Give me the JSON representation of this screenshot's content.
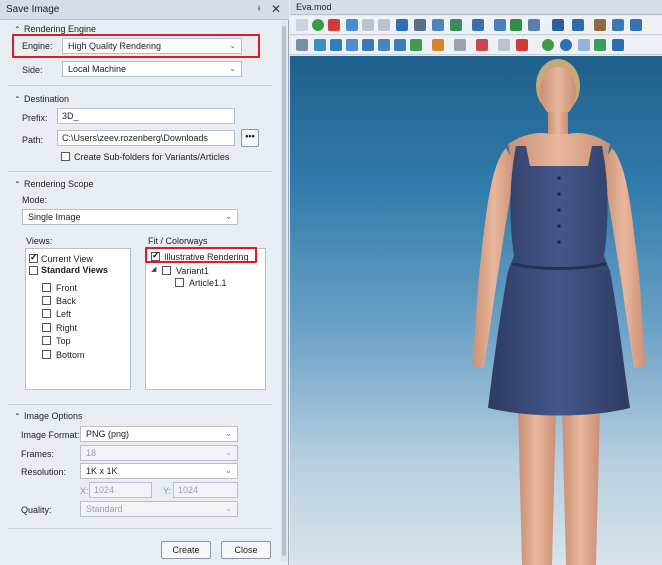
{
  "dialog": {
    "title": "Save Image",
    "pin_glyph": "ᵼ",
    "close_glyph": "✕"
  },
  "rendering_engine": {
    "header": "Rendering Engine",
    "engine_label": "Engine:",
    "engine_value": "High Quality Rendering",
    "side_label": "Side:",
    "side_value": "Local Machine"
  },
  "destination": {
    "header": "Destination",
    "prefix_label": "Prefix:",
    "prefix_value": "3D_",
    "path_label": "Path:",
    "path_value": "C:\\Users\\zeev.rozenberg\\Downloads",
    "browse_label": "•••",
    "subfolders_label": "Create Sub-folders for Variants/Articles",
    "subfolders_checked": false
  },
  "rendering_scope": {
    "header": "Rendering Scope",
    "mode_label": "Mode:",
    "mode_value": "Single Image",
    "views_label": "Views:",
    "fit_label": "Fit / Colorways",
    "views": {
      "current_view": "Current View",
      "standard_views": "Standard Views",
      "items": [
        "Front",
        "Back",
        "Left",
        "Right",
        "Top",
        "Bottom"
      ]
    },
    "fit": {
      "illustrative": "Illustrative Rendering",
      "variant": "Variant1",
      "article": "Article1.1"
    }
  },
  "image_options": {
    "header": "Image Options",
    "format_label": "Image Format:",
    "format_value": "PNG (png)",
    "frames_label": "Frames:",
    "frames_value": "18",
    "resolution_label": "Resolution:",
    "resolution_value": "1K x 1K",
    "x_label": "X:",
    "x_value": "1024",
    "y_label": "Y:",
    "y_value": "1024",
    "quality_label": "Quality:",
    "quality_value": "Standard"
  },
  "buttons": {
    "create": "Create",
    "close": "Close"
  },
  "view": {
    "title": "Eva.mod"
  },
  "colors": {
    "highlight": "#e01b24",
    "dress": "#3b4d7a",
    "background_top": "#1f5f8c",
    "background_bottom": "#d8e3ec"
  }
}
